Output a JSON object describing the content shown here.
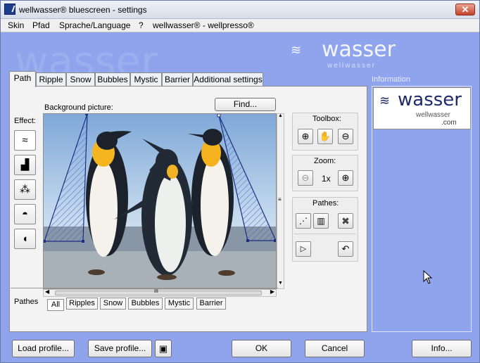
{
  "window": {
    "title": "wellwasser® bluescreen - settings",
    "close_glyph": "✕"
  },
  "menu": [
    "Skin",
    "Pfad",
    "Sprache/Language",
    "?",
    "wellwasser® - wellpresso®"
  ],
  "watermark": {
    "text": "wasser",
    "logo_text": "wasser",
    "logo_subtext": "wellwasser"
  },
  "tabs": [
    "Path",
    "Ripple",
    "Snow",
    "Bubbles",
    "Mystic",
    "Barrier",
    "Additional settings"
  ],
  "active_tab": "Path",
  "path_tab": {
    "background_label": "Background picture:",
    "find_button": "Find...",
    "effect_label": "Effect:",
    "effects": [
      "waves-icon",
      "ripple-icon",
      "snow-icon",
      "bubbles-icon",
      "pacman-icon"
    ],
    "toolbox": {
      "label": "Toolbox:",
      "tools": [
        "zoom-in-icon",
        "hand-icon",
        "zoom-out-icon"
      ]
    },
    "zoom": {
      "label": "Zoom:",
      "value": "1x"
    },
    "pathes": {
      "label": "Pathes:",
      "tools": [
        "path-nodes-icon",
        "trash-icon",
        "delete-x-icon"
      ]
    },
    "extra_tools": [
      "play-triangle-icon",
      "undo-icon"
    ],
    "pathes_label": "Pathes",
    "path_tabs": [
      "All",
      "Ripples",
      "Snow",
      "Bubbles",
      "Mystic",
      "Barrier"
    ],
    "active_path_tab": "All",
    "scroll_grip": "III"
  },
  "info": {
    "label": "Information",
    "logo_text": "wasser",
    "logo_sub1": "wellwasser",
    "logo_sub2": ".com"
  },
  "bottom": {
    "load": "Load profile...",
    "save": "Save profile...",
    "ok": "OK",
    "cancel": "Cancel",
    "info": "Info..."
  },
  "colors": {
    "background": "#8fa4ec",
    "panel": "#f3f3f3",
    "logo_blue": "#1d2a6b"
  }
}
